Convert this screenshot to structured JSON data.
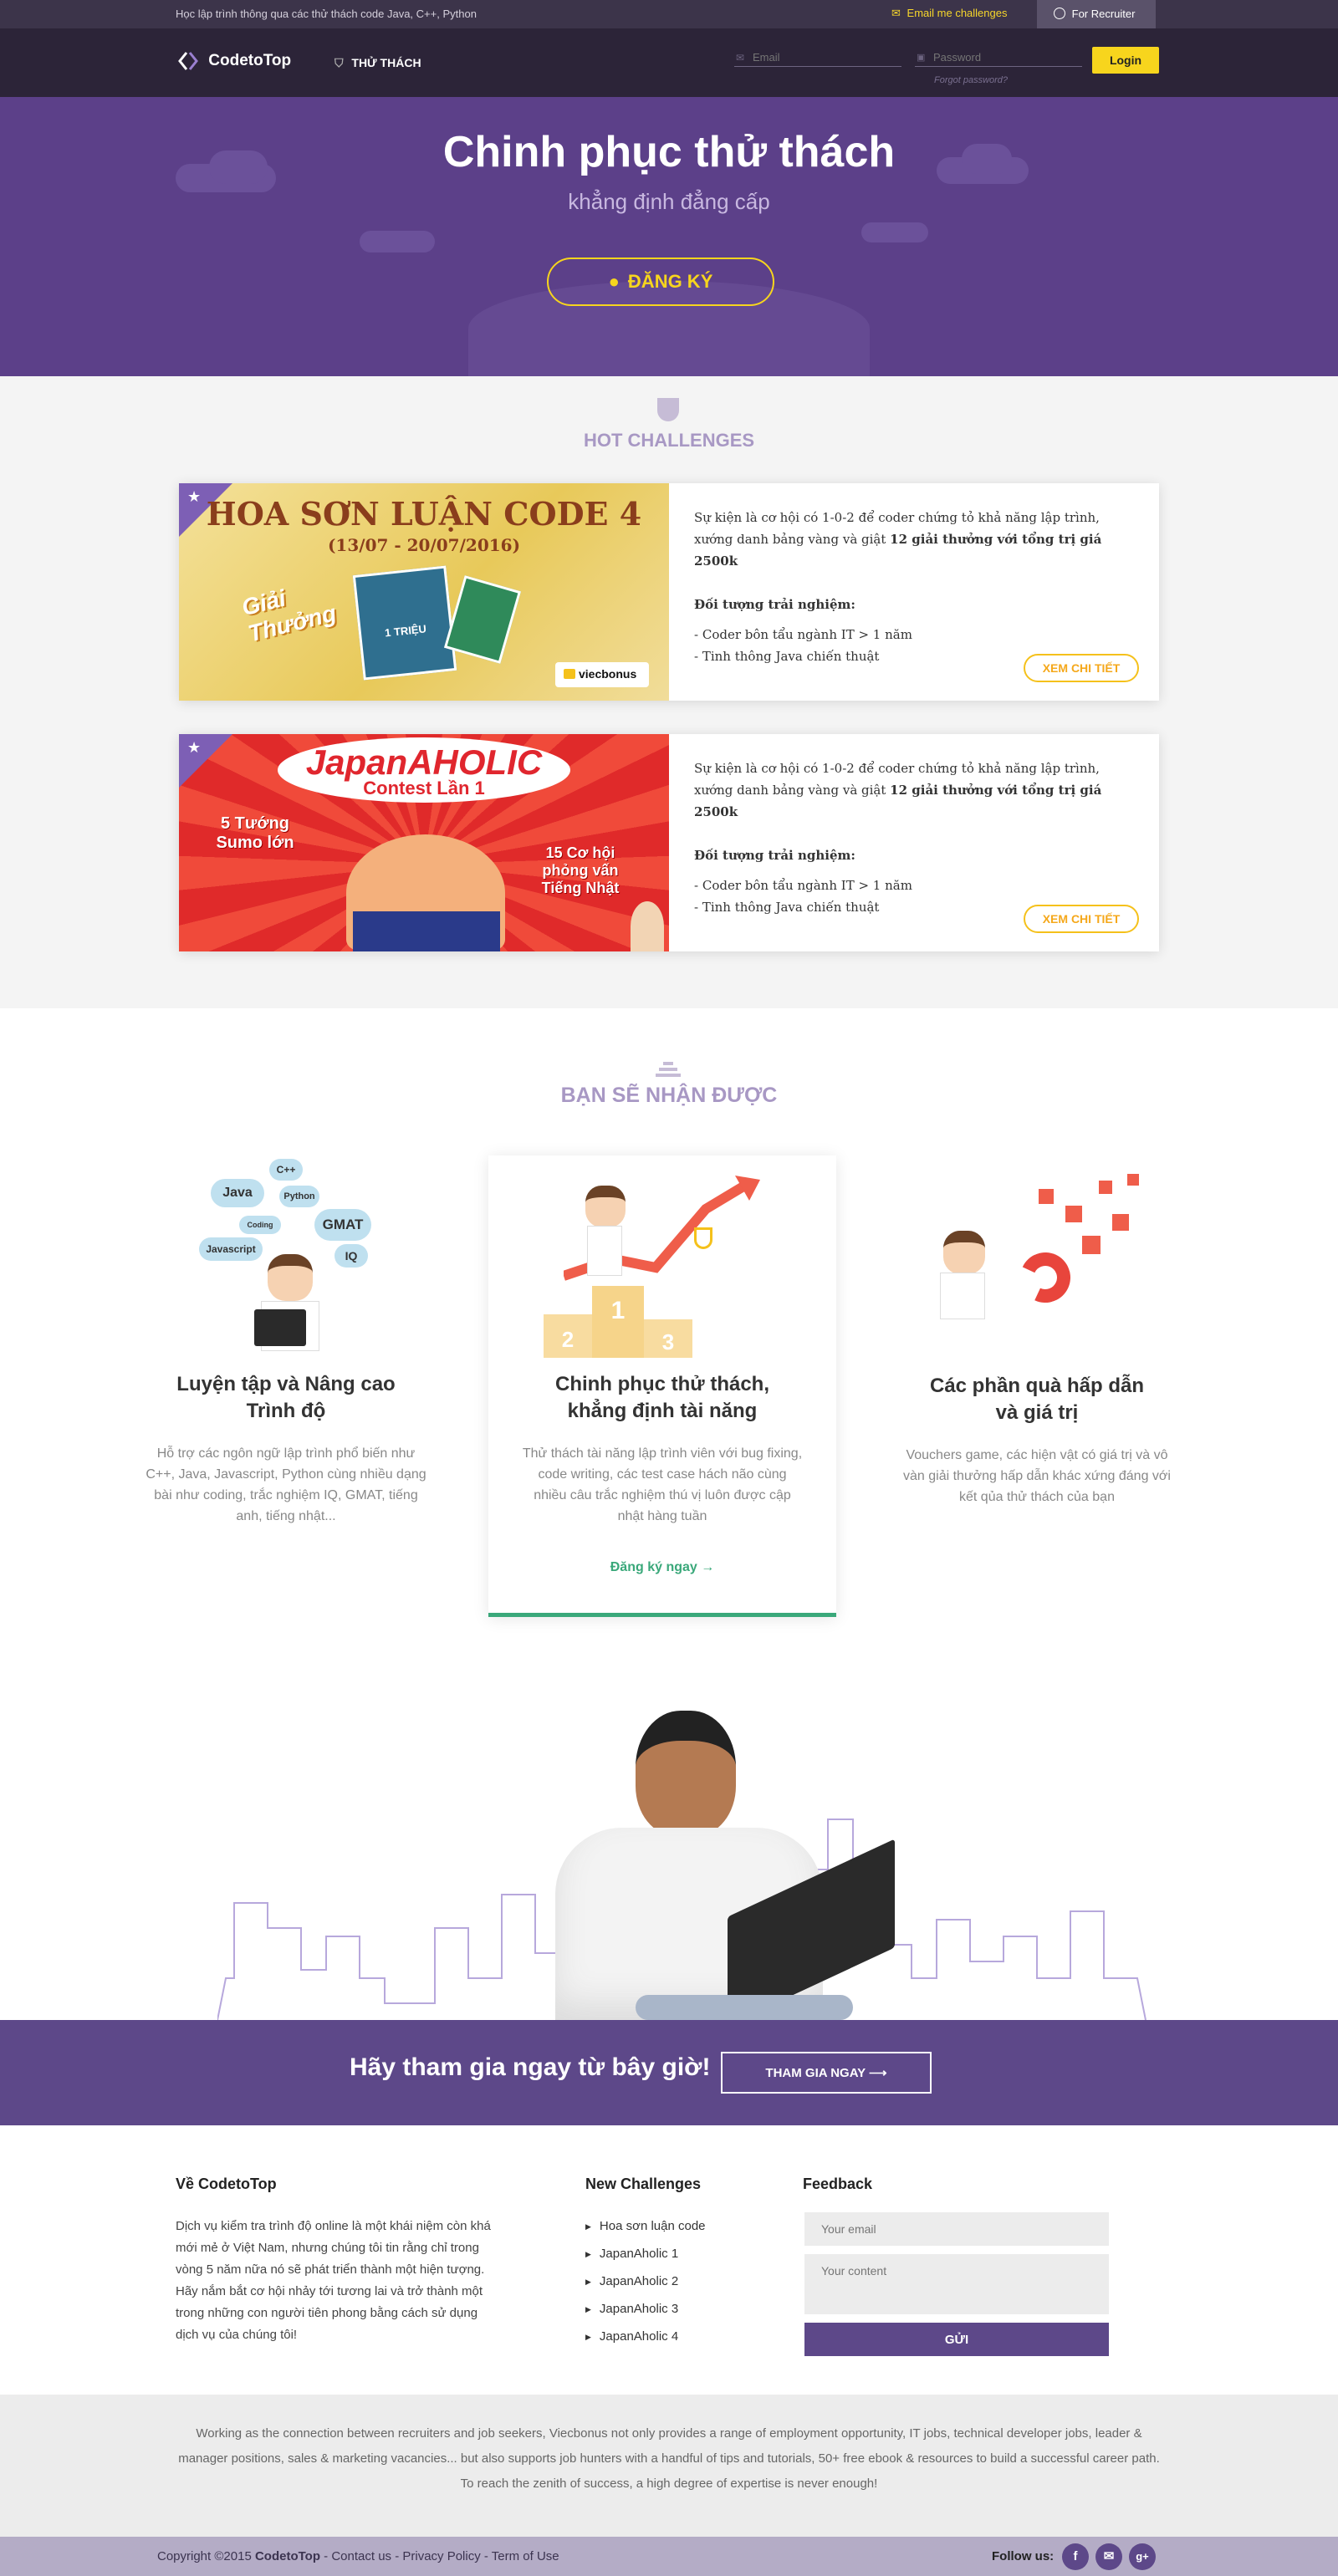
{
  "topbar": {
    "tagline": "Học lập trình thông qua các thử thách code Java, C++, Python",
    "email_me": "Email me challenges",
    "recruiter": "For Recruiter"
  },
  "nav": {
    "logo": "CodetoTop",
    "challenges": "THỬ THÁCH",
    "email_placeholder": "Email",
    "password_placeholder": "Password",
    "forgot": "Forgot password?",
    "login": "Login"
  },
  "hero": {
    "title": "Chinh phục thử thách",
    "subtitle": "khẳng định đẳng cấp",
    "register": "ĐĂNG KÝ"
  },
  "hot": {
    "title": "HOT CHALLENGES",
    "cards": [
      {
        "banner_title": "HOA SƠN LUẬN CODE 4",
        "banner_dates": "(13/07 - 20/07/2016)",
        "banner_prize": "Giải Thưởng",
        "banner_voucher": "1 TRIỆU",
        "banner_brand": "viecbonus",
        "intro": "Sự kiện là cơ hội có 1-0-2 để coder chứng tỏ khả năng lập trình, xướng danh bảng vàng và giật ",
        "intro_bold": "12 giải thưởng với tổng trị giá 2500k",
        "target_label": "Đối tượng trải nghiệm:",
        "target_1": "- Coder bôn tẩu ngành IT > 1 năm",
        "target_2": "- Tinh thông Java chiến thuật",
        "button": "XEM CHI TIẾT"
      },
      {
        "banner_title": "JapanAHOLIC",
        "banner_sub": "Contest Lần 1",
        "banner_left": "5 Tướng Sumo lớn",
        "banner_right": "15 Cơ hội phỏng vấn Tiếng Nhật",
        "intro": "Sự kiện là cơ hội có 1-0-2 để coder chứng tỏ khả năng lập trình, xướng danh bảng vàng và giật ",
        "intro_bold": "12 giải thưởng với tổng trị giá 2500k",
        "target_label": "Đối tượng trải nghiệm:",
        "target_1": "- Coder bôn tẩu ngành IT > 1 năm",
        "target_2": "- Tinh thông Java chiến thuật",
        "button": "XEM CHI TIẾT"
      }
    ]
  },
  "benefits": {
    "title": "BẠN SẼ NHẬN ĐƯỢC",
    "cloud_tags": [
      "C++",
      "Java",
      "Python",
      "Coding",
      "GMAT",
      "Javascript",
      "IQ"
    ],
    "podium": [
      "1",
      "2",
      "3"
    ],
    "items": [
      {
        "title_1": "Luyện tập và Nâng cao",
        "title_2": "Trình độ",
        "text": "Hỗ trợ các ngôn ngữ lập trình phổ biến như C++, Java, Javascript, Python cùng nhiều dạng bài như coding, trắc nghiệm IQ, GMAT, tiếng anh, tiếng nhật..."
      },
      {
        "title_1": "Chinh phục thử thách,",
        "title_2": "khẳng định tài năng",
        "text": "Thử thách tài năng lập trình viên với bug fixing, code writing, các test case hách não cùng nhiều câu trắc nghiệm thú vị luôn được cập nhật hàng tuần",
        "cta": "Đăng ký ngay →"
      },
      {
        "title_1": "Các phần quà hấp dẫn",
        "title_2": "và giá trị",
        "text": "Vouchers game, các hiện vật có giá trị và vô vàn giải thưởng hấp dẫn khác xứng đáng với kết qủa thử thách của bạn"
      }
    ]
  },
  "join": {
    "text": "Hãy tham gia ngay từ bây giờ!",
    "button": "THAM GIA NGAY ⟶"
  },
  "footer": {
    "about_title": "Về CodetoTop",
    "about_text": "Dịch vụ kiểm tra trình độ online là một khái niệm còn khá mới mẻ ở Việt Nam, nhưng chúng tôi tin rằng chỉ trong vòng 5 năm nữa nó sẽ phát triển thành một hiện tượng. Hãy nắm bắt cơ hội nhảy tới tương lai và trở thành một trong những con người tiên phong bằng cách sử dụng dịch vụ của chúng tôi!",
    "challenges_title": "New Challenges",
    "challenges": [
      "Hoa sơn luận code",
      "JapanAholic 1",
      "JapanAholic 2",
      "JapanAholic 3",
      "JapanAholic 4"
    ],
    "feedback_title": "Feedback",
    "email_placeholder": "Your email",
    "content_placeholder": "Your content",
    "send": "GỬI"
  },
  "disclaimer": {
    "line1": "Working as the connection between recruiters and job seekers, Viecbonus not only provides a range of employment opportunity, IT jobs, technical developer jobs, leader &",
    "line2": "manager positions, sales & marketing vacancies... but also supports job hunters with a handful of tips and tutorials, 50+ free ebook & resources to build a successful career path.",
    "line3": "To reach the zenith of success, a high degree of expertise is never enough!"
  },
  "bottom": {
    "copyright": "Copyright ©2015 ",
    "brand": "CodetoTop",
    "links": " - Contact us - Privacy Policy - Term of Use",
    "follow": "Follow us:",
    "socials": [
      "f",
      "✉",
      "g+"
    ]
  },
  "colors": {
    "primary": "#5d4889",
    "accent": "#f7d51d",
    "success": "#3aa87a"
  }
}
